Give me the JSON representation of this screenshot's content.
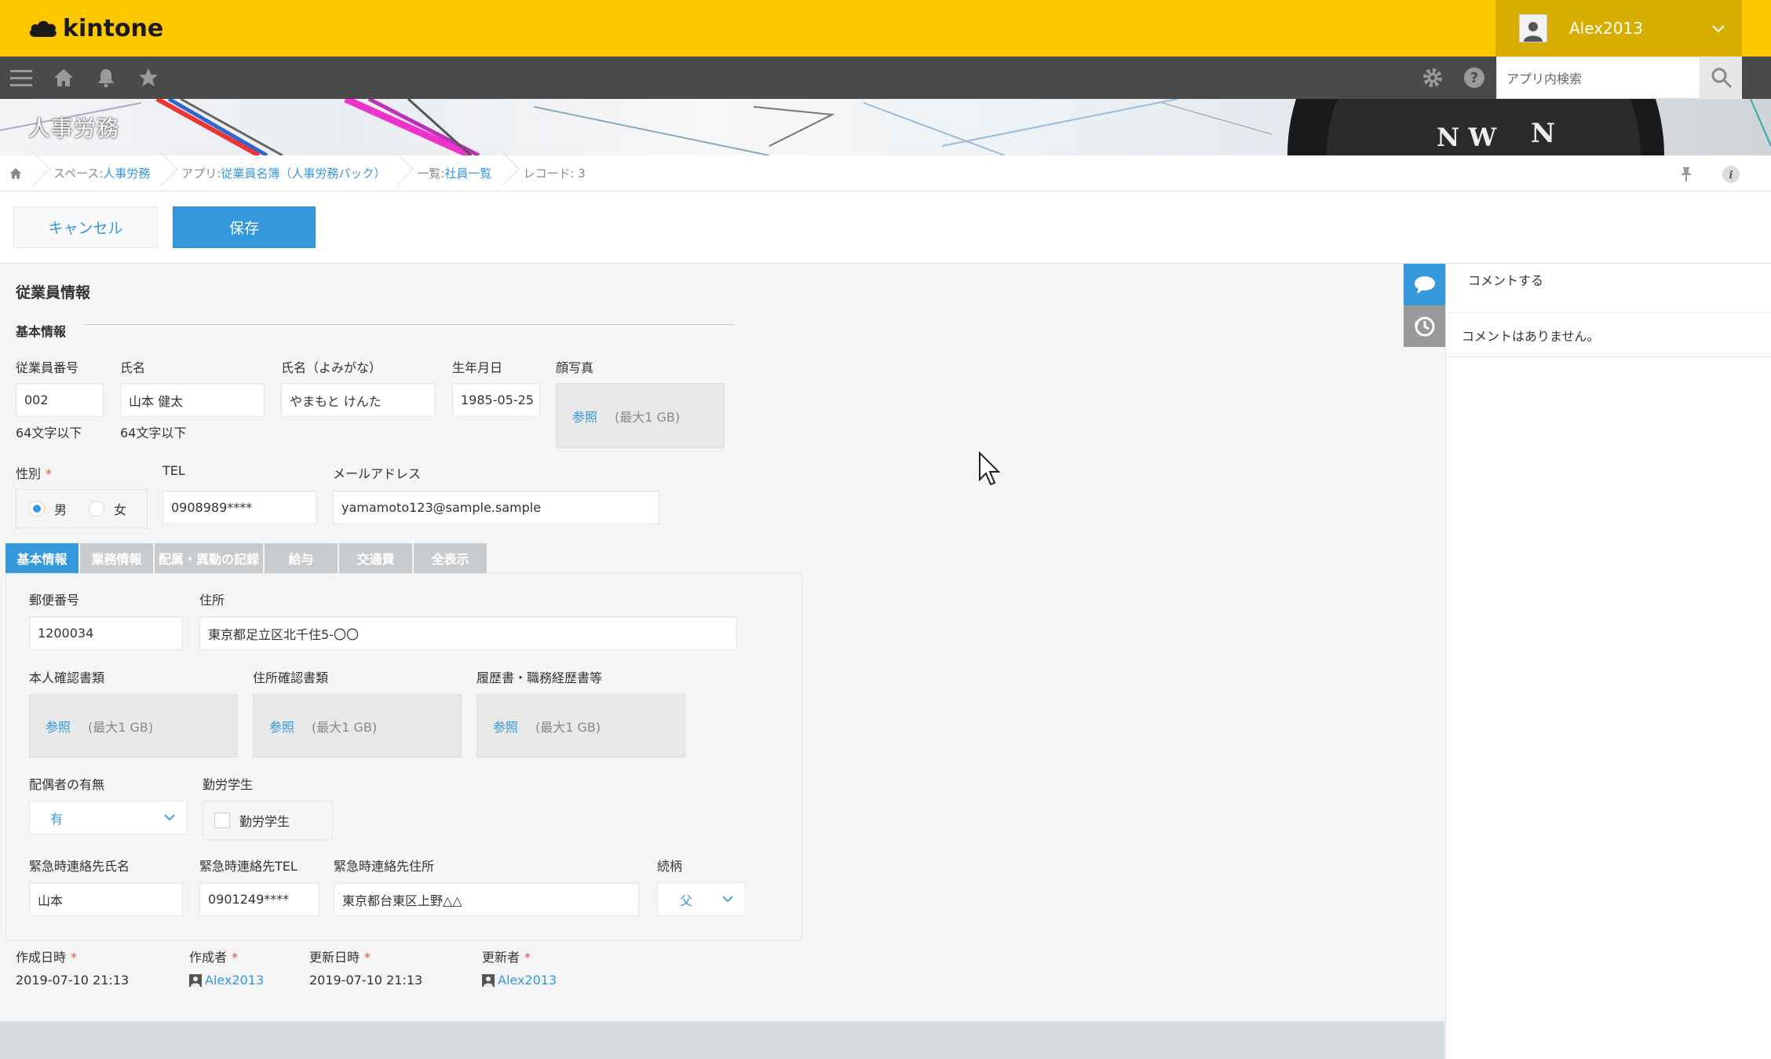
{
  "app": {
    "logo_text": "kintone",
    "user_name": "Alex2013"
  },
  "nav": {
    "search_placeholder": "アプリ内検索"
  },
  "banner": {
    "title": "人事労務"
  },
  "breadcrumb": {
    "space_prefix": "スペース: ",
    "space_name": "人事労務",
    "app_prefix": "アプリ: ",
    "app_name": "従業員名簿（人事労務パック）",
    "list_prefix": "一覧: ",
    "list_name": "社員一覧",
    "record": "レコード: 3"
  },
  "actions": {
    "cancel_label": "キャンセル",
    "save_label": "保存"
  },
  "form": {
    "section_title": "従業員情報",
    "basic_info_title": "基本情報",
    "employee_no": {
      "label": "従業員番号",
      "value": "002",
      "hint": "64文字以下"
    },
    "name": {
      "label": "氏名",
      "value": "山本 健太",
      "hint": "64文字以下"
    },
    "name_kana": {
      "label": "氏名（よみがな）",
      "value": "やまもと けんた"
    },
    "birthday": {
      "label": "生年月日",
      "value": "1985-05-25"
    },
    "photo": {
      "label": "顔写真",
      "ref": "参照",
      "limit": "(最大1 GB)"
    },
    "gender": {
      "label": "性別",
      "required": "*",
      "options": [
        "男",
        "女"
      ],
      "selected": "男"
    },
    "tel": {
      "label": "TEL",
      "value": "0908989****"
    },
    "email": {
      "label": "メールアドレス",
      "value": "yamamoto123@sample.sample"
    },
    "tabs": [
      "基本情報",
      "業務情報",
      "配属・異動の記録",
      "給与",
      "交通費",
      "全表示"
    ],
    "active_tab": "基本情報",
    "postal": {
      "label": "郵便番号",
      "value": "1200034"
    },
    "address": {
      "label": "住所",
      "value": "東京都足立区北千住5-〇〇"
    },
    "id_doc": {
      "label": "本人確認書類",
      "ref": "参照",
      "limit": "(最大1 GB)"
    },
    "address_doc": {
      "label": "住所確認書類",
      "ref": "参照",
      "limit": "(最大1 GB)"
    },
    "resume": {
      "label": "履歴書・職務経歴書等",
      "ref": "参照",
      "limit": "(最大1 GB)"
    },
    "spouse": {
      "label": "配偶者の有無",
      "value": "有"
    },
    "working_student": {
      "label": "勤労学生",
      "option": "勤労学生"
    },
    "emergency_name": {
      "label": "緊急時連絡先氏名",
      "value": "山本"
    },
    "emergency_tel": {
      "label": "緊急時連絡先TEL",
      "value": "0901249****"
    },
    "emergency_address": {
      "label": "緊急時連絡先住所",
      "value": "東京都台東区上野△△"
    },
    "relation": {
      "label": "続柄",
      "value": "父"
    },
    "created_at": {
      "label": "作成日時",
      "value": "2019-07-10 21:13"
    },
    "creator": {
      "label": "作成者",
      "value": "Alex2013"
    },
    "updated_at": {
      "label": "更新日時",
      "value": "2019-07-10 21:13"
    },
    "updater": {
      "label": "更新者",
      "value": "Alex2013"
    },
    "required_mark": "*"
  },
  "comments": {
    "entry_label": "コメントする",
    "empty_text": "コメントはありません。"
  },
  "colors": {
    "accent": "#3498db",
    "topbar": "#fec800",
    "navbar": "#4a4a4a",
    "required": "#e74c3c"
  }
}
